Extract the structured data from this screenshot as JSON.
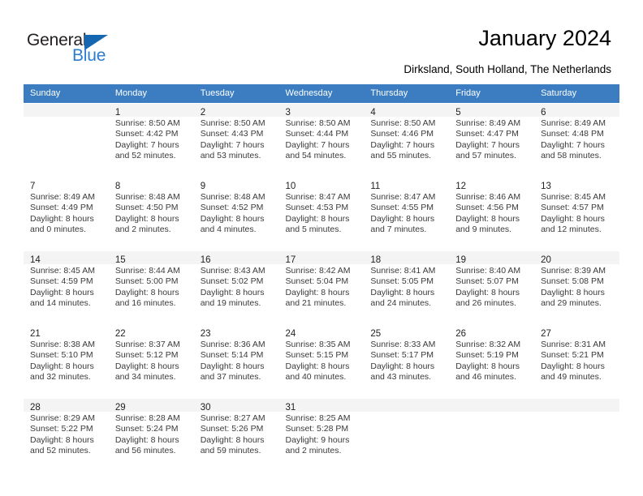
{
  "brand": {
    "name_part1": "General",
    "name_part2": "Blue",
    "accent_color": "#2b7dd0",
    "triangle_color": "#1667b2"
  },
  "header": {
    "title": "January 2024",
    "subtitle": "Dirksland, South Holland, The Netherlands"
  },
  "theme": {
    "header_row_bg": "#3b7dc0",
    "header_row_text": "#ffffff",
    "shaded_row_bg": "#f4f4f4"
  },
  "weekday_headers": [
    "Sunday",
    "Monday",
    "Tuesday",
    "Wednesday",
    "Thursday",
    "Friday",
    "Saturday"
  ],
  "weeks": [
    {
      "shaded": true,
      "days": [
        {
          "num": "",
          "sunrise": "",
          "sunset": "",
          "daylight1": "",
          "daylight2": "",
          "empty": true
        },
        {
          "num": "1",
          "sunrise": "Sunrise: 8:50 AM",
          "sunset": "Sunset: 4:42 PM",
          "daylight1": "Daylight: 7 hours",
          "daylight2": "and 52 minutes."
        },
        {
          "num": "2",
          "sunrise": "Sunrise: 8:50 AM",
          "sunset": "Sunset: 4:43 PM",
          "daylight1": "Daylight: 7 hours",
          "daylight2": "and 53 minutes."
        },
        {
          "num": "3",
          "sunrise": "Sunrise: 8:50 AM",
          "sunset": "Sunset: 4:44 PM",
          "daylight1": "Daylight: 7 hours",
          "daylight2": "and 54 minutes."
        },
        {
          "num": "4",
          "sunrise": "Sunrise: 8:50 AM",
          "sunset": "Sunset: 4:46 PM",
          "daylight1": "Daylight: 7 hours",
          "daylight2": "and 55 minutes."
        },
        {
          "num": "5",
          "sunrise": "Sunrise: 8:49 AM",
          "sunset": "Sunset: 4:47 PM",
          "daylight1": "Daylight: 7 hours",
          "daylight2": "and 57 minutes."
        },
        {
          "num": "6",
          "sunrise": "Sunrise: 8:49 AM",
          "sunset": "Sunset: 4:48 PM",
          "daylight1": "Daylight: 7 hours",
          "daylight2": "and 58 minutes."
        }
      ]
    },
    {
      "shaded": false,
      "days": [
        {
          "num": "7",
          "sunrise": "Sunrise: 8:49 AM",
          "sunset": "Sunset: 4:49 PM",
          "daylight1": "Daylight: 8 hours",
          "daylight2": "and 0 minutes."
        },
        {
          "num": "8",
          "sunrise": "Sunrise: 8:48 AM",
          "sunset": "Sunset: 4:50 PM",
          "daylight1": "Daylight: 8 hours",
          "daylight2": "and 2 minutes."
        },
        {
          "num": "9",
          "sunrise": "Sunrise: 8:48 AM",
          "sunset": "Sunset: 4:52 PM",
          "daylight1": "Daylight: 8 hours",
          "daylight2": "and 4 minutes."
        },
        {
          "num": "10",
          "sunrise": "Sunrise: 8:47 AM",
          "sunset": "Sunset: 4:53 PM",
          "daylight1": "Daylight: 8 hours",
          "daylight2": "and 5 minutes."
        },
        {
          "num": "11",
          "sunrise": "Sunrise: 8:47 AM",
          "sunset": "Sunset: 4:55 PM",
          "daylight1": "Daylight: 8 hours",
          "daylight2": "and 7 minutes."
        },
        {
          "num": "12",
          "sunrise": "Sunrise: 8:46 AM",
          "sunset": "Sunset: 4:56 PM",
          "daylight1": "Daylight: 8 hours",
          "daylight2": "and 9 minutes."
        },
        {
          "num": "13",
          "sunrise": "Sunrise: 8:45 AM",
          "sunset": "Sunset: 4:57 PM",
          "daylight1": "Daylight: 8 hours",
          "daylight2": "and 12 minutes."
        }
      ]
    },
    {
      "shaded": true,
      "days": [
        {
          "num": "14",
          "sunrise": "Sunrise: 8:45 AM",
          "sunset": "Sunset: 4:59 PM",
          "daylight1": "Daylight: 8 hours",
          "daylight2": "and 14 minutes."
        },
        {
          "num": "15",
          "sunrise": "Sunrise: 8:44 AM",
          "sunset": "Sunset: 5:00 PM",
          "daylight1": "Daylight: 8 hours",
          "daylight2": "and 16 minutes."
        },
        {
          "num": "16",
          "sunrise": "Sunrise: 8:43 AM",
          "sunset": "Sunset: 5:02 PM",
          "daylight1": "Daylight: 8 hours",
          "daylight2": "and 19 minutes."
        },
        {
          "num": "17",
          "sunrise": "Sunrise: 8:42 AM",
          "sunset": "Sunset: 5:04 PM",
          "daylight1": "Daylight: 8 hours",
          "daylight2": "and 21 minutes."
        },
        {
          "num": "18",
          "sunrise": "Sunrise: 8:41 AM",
          "sunset": "Sunset: 5:05 PM",
          "daylight1": "Daylight: 8 hours",
          "daylight2": "and 24 minutes."
        },
        {
          "num": "19",
          "sunrise": "Sunrise: 8:40 AM",
          "sunset": "Sunset: 5:07 PM",
          "daylight1": "Daylight: 8 hours",
          "daylight2": "and 26 minutes."
        },
        {
          "num": "20",
          "sunrise": "Sunrise: 8:39 AM",
          "sunset": "Sunset: 5:08 PM",
          "daylight1": "Daylight: 8 hours",
          "daylight2": "and 29 minutes."
        }
      ]
    },
    {
      "shaded": false,
      "days": [
        {
          "num": "21",
          "sunrise": "Sunrise: 8:38 AM",
          "sunset": "Sunset: 5:10 PM",
          "daylight1": "Daylight: 8 hours",
          "daylight2": "and 32 minutes."
        },
        {
          "num": "22",
          "sunrise": "Sunrise: 8:37 AM",
          "sunset": "Sunset: 5:12 PM",
          "daylight1": "Daylight: 8 hours",
          "daylight2": "and 34 minutes."
        },
        {
          "num": "23",
          "sunrise": "Sunrise: 8:36 AM",
          "sunset": "Sunset: 5:14 PM",
          "daylight1": "Daylight: 8 hours",
          "daylight2": "and 37 minutes."
        },
        {
          "num": "24",
          "sunrise": "Sunrise: 8:35 AM",
          "sunset": "Sunset: 5:15 PM",
          "daylight1": "Daylight: 8 hours",
          "daylight2": "and 40 minutes."
        },
        {
          "num": "25",
          "sunrise": "Sunrise: 8:33 AM",
          "sunset": "Sunset: 5:17 PM",
          "daylight1": "Daylight: 8 hours",
          "daylight2": "and 43 minutes."
        },
        {
          "num": "26",
          "sunrise": "Sunrise: 8:32 AM",
          "sunset": "Sunset: 5:19 PM",
          "daylight1": "Daylight: 8 hours",
          "daylight2": "and 46 minutes."
        },
        {
          "num": "27",
          "sunrise": "Sunrise: 8:31 AM",
          "sunset": "Sunset: 5:21 PM",
          "daylight1": "Daylight: 8 hours",
          "daylight2": "and 49 minutes."
        }
      ]
    },
    {
      "shaded": true,
      "days": [
        {
          "num": "28",
          "sunrise": "Sunrise: 8:29 AM",
          "sunset": "Sunset: 5:22 PM",
          "daylight1": "Daylight: 8 hours",
          "daylight2": "and 52 minutes."
        },
        {
          "num": "29",
          "sunrise": "Sunrise: 8:28 AM",
          "sunset": "Sunset: 5:24 PM",
          "daylight1": "Daylight: 8 hours",
          "daylight2": "and 56 minutes."
        },
        {
          "num": "30",
          "sunrise": "Sunrise: 8:27 AM",
          "sunset": "Sunset: 5:26 PM",
          "daylight1": "Daylight: 8 hours",
          "daylight2": "and 59 minutes."
        },
        {
          "num": "31",
          "sunrise": "Sunrise: 8:25 AM",
          "sunset": "Sunset: 5:28 PM",
          "daylight1": "Daylight: 9 hours",
          "daylight2": "and 2 minutes."
        },
        {
          "num": "",
          "sunrise": "",
          "sunset": "",
          "daylight1": "",
          "daylight2": "",
          "empty": true
        },
        {
          "num": "",
          "sunrise": "",
          "sunset": "",
          "daylight1": "",
          "daylight2": "",
          "empty": true
        },
        {
          "num": "",
          "sunrise": "",
          "sunset": "",
          "daylight1": "",
          "daylight2": "",
          "empty": true
        }
      ]
    }
  ]
}
